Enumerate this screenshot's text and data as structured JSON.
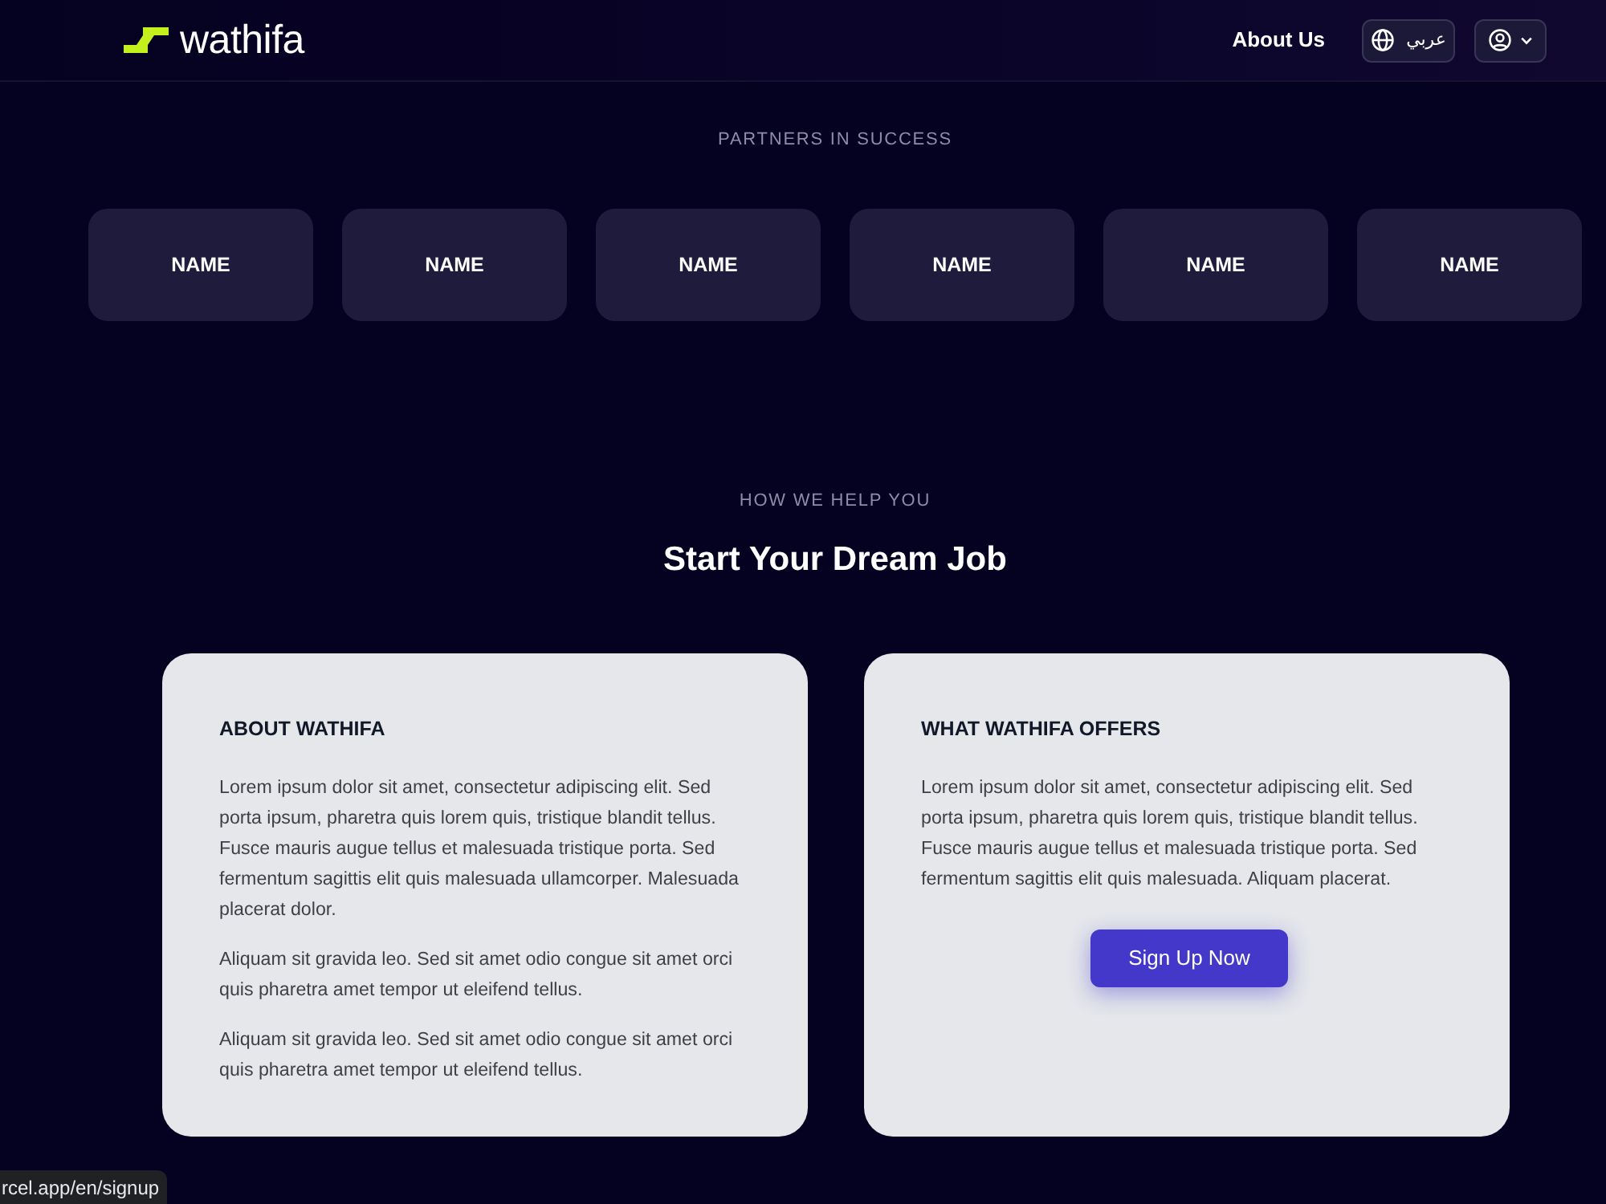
{
  "header": {
    "logo_text": "wathifa",
    "nav_link": "About Us",
    "language_button": "عربي"
  },
  "partners": {
    "label": "PARTNERS IN SUCCESS",
    "items": [
      "NAME",
      "NAME",
      "NAME",
      "NAME",
      "NAME",
      "NAME"
    ]
  },
  "help": {
    "eyebrow": "HOW WE HELP YOU",
    "title": "Start Your Dream Job",
    "cards": [
      {
        "heading": "ABOUT WATHIFA",
        "paragraphs": [
          "Lorem ipsum dolor sit amet, consectetur adipiscing elit. Sed porta ipsum, pharetra quis lorem quis, tristique blandit tellus. Fusce mauris augue tellus et malesuada tristique porta. Sed fermentum sagittis elit quis malesuada ullamcorper. Malesuada placerat dolor.",
          "Aliquam sit gravida leo. Sed sit amet odio congue sit amet orci quis pharetra amet tempor ut eleifend tellus.",
          "Aliquam sit gravida leo. Sed sit amet odio congue sit amet orci quis pharetra amet tempor ut eleifend tellus."
        ]
      },
      {
        "heading": "WHAT WATHIFA OFFERS",
        "paragraphs": [
          "Lorem ipsum dolor sit amet, consectetur adipiscing elit. Sed porta ipsum, pharetra quis lorem quis, tristique blandit tellus. Fusce mauris augue tellus et malesuada tristique porta. Sed fermentum sagittis elit quis malesuada. Aliquam placerat."
        ],
        "button": "Sign Up Now"
      }
    ]
  },
  "status_url": "rcel.app/en/signup"
}
